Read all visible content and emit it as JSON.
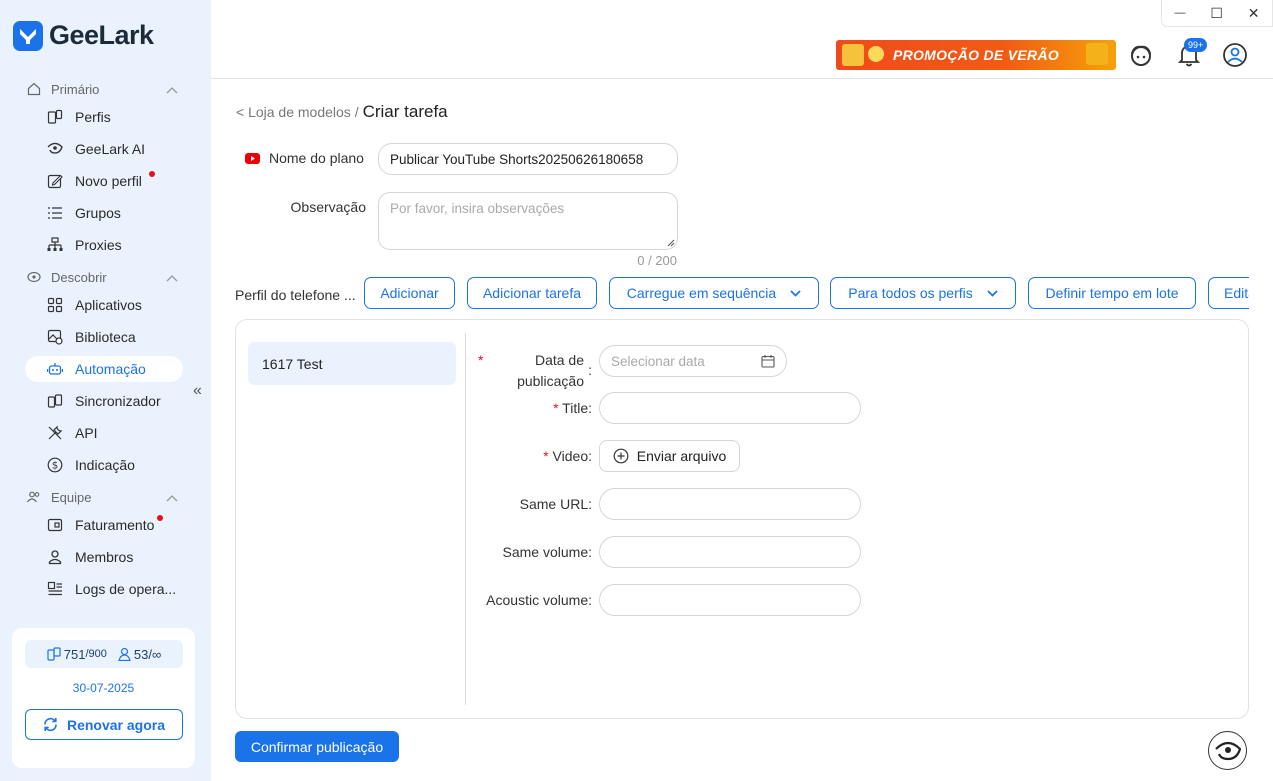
{
  "app": {
    "name": "GeeLark"
  },
  "window_controls": {
    "minimize": "—",
    "maximize": "☐",
    "close": "✕"
  },
  "topbar": {
    "promo": "PROMOÇÃO DE VERÃO",
    "notifications_badge": "99+"
  },
  "sidebar": {
    "section_primary": "Primário",
    "section_discover": "Descobrir",
    "section_team": "Equipe",
    "items": {
      "perfis": "Perfis",
      "geelark_ai": "GeeLark AI",
      "novo_perfil": "Novo perfil",
      "grupos": "Grupos",
      "proxies": "Proxies",
      "aplicativos": "Aplicativos",
      "biblioteca": "Biblioteca",
      "automacao": "Automação",
      "sincronizador": "Sincronizador",
      "api": "API",
      "indicacao": "Indicação",
      "faturamento": "Faturamento",
      "membros": "Membros",
      "logs": "Logs de opera..."
    },
    "plan": {
      "profiles_used": "751",
      "profiles_total": "/900",
      "members_used": "53",
      "members_total": "/∞",
      "expiry": "30-07-2025",
      "renew": "Renovar agora"
    }
  },
  "breadcrumb": {
    "parent": "< Loja de modelos /",
    "current": "Criar tarefa"
  },
  "form": {
    "plan_name_label": "Nome do plano",
    "plan_name_value": "Publicar YouTube Shorts20250626180658",
    "note_label": "Observação",
    "note_placeholder": "Por favor, insira observações",
    "note_counter": "0 / 200",
    "profile_label": "Perfil do telefone ..."
  },
  "toolbar": {
    "add": "Adicionar",
    "add_task": "Adicionar tarefa",
    "load_sequence": "Carregue em sequência",
    "all_profiles": "Para todos os perfis",
    "batch_time": "Definir tempo em lote",
    "edit": "Edita"
  },
  "profiles": [
    "1617 Test"
  ],
  "task_form": {
    "date_label_1": "Data de",
    "date_label_2": "publicação",
    "date_placeholder": "Selecionar data",
    "title_label": "Title",
    "video_label": "Video",
    "upload_button": "Enviar arquivo",
    "same_url_label": "Same URL",
    "same_volume_label": "Same volume",
    "acoustic_volume_label": "Acoustic volume"
  },
  "actions": {
    "confirm": "Confirmar publicação"
  }
}
